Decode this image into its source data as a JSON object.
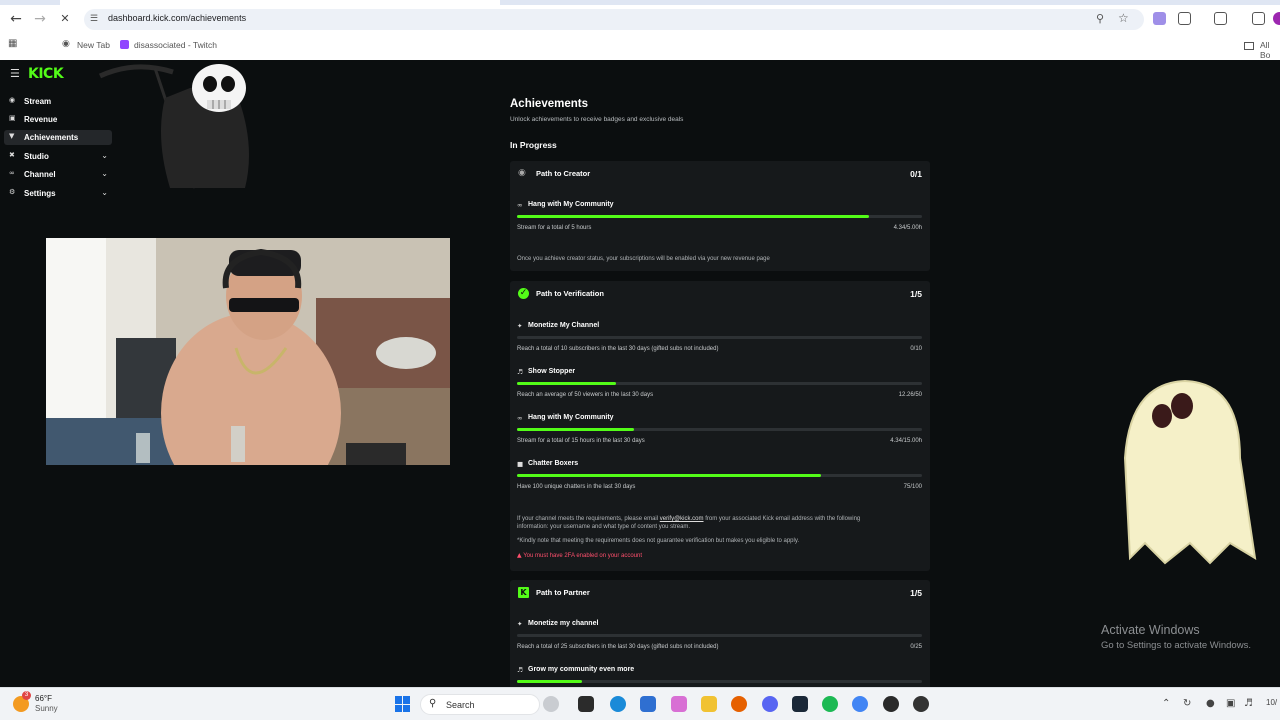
{
  "browser": {
    "url": "dashboard.kick.com/achievements",
    "bookmarks": [
      "New Tab",
      "disassociated - Twitch"
    ],
    "all_bookmarks": "All Bo"
  },
  "sidebar": {
    "logo": "KICK",
    "items": [
      {
        "label": "Stream",
        "icon": "broadcast-icon",
        "expandable": false
      },
      {
        "label": "Revenue",
        "icon": "revenue-icon",
        "expandable": false
      },
      {
        "label": "Achievements",
        "icon": "trophy-icon",
        "expandable": false,
        "active": true
      },
      {
        "label": "Studio",
        "icon": "studio-icon",
        "expandable": true
      },
      {
        "label": "Channel",
        "icon": "channel-icon",
        "expandable": true
      },
      {
        "label": "Settings",
        "icon": "gear-icon",
        "expandable": true
      }
    ]
  },
  "main": {
    "title": "Achievements",
    "subtitle": "Unlock achievements to receive badges and exclusive deals",
    "section": "In Progress",
    "cards": [
      {
        "title": "Path to Creator",
        "count": "0/1",
        "icon": "broadcast-icon",
        "tasks": [
          {
            "name": "Hang with My Community",
            "desc": "Stream for a total of 5 hours",
            "value": "4.34/5.00h",
            "progress": 0.868
          }
        ],
        "note": "Once you achieve creator status, your subscriptions will be enabled via your new revenue page"
      },
      {
        "title": "Path to Verification",
        "count": "1/5",
        "icon": "verified-badge-icon",
        "tasks": [
          {
            "name": "Monetize My Channel",
            "desc": "Reach a total of 10 subscribers in the last 30 days (gifted subs not included)",
            "value": "0/10",
            "progress": 0
          },
          {
            "name": "Show Stopper",
            "desc": "Reach an average of 50 viewers in the last 30 days",
            "value": "12.26/50",
            "progress": 0.245
          },
          {
            "name": "Hang with My Community",
            "desc": "Stream for a total of 15 hours in the last 30 days",
            "value": "4.34/15.00h",
            "progress": 0.289
          },
          {
            "name": "Chatter Boxers",
            "desc": "Have 100 unique chatters in the last 30 days",
            "value": "75/100",
            "progress": 0.75
          }
        ],
        "note1_before": "If your channel meets the requirements, please email",
        "note1_email": "verify@kick.com",
        "note1_after": "from your associated Kick email address with the following",
        "note2": "information: your username and what type of content you stream.",
        "note3": "*Kindly note that meeting the requirements does not guarantee verification but makes you eligible to apply.",
        "warning": "You must have 2FA enabled on your account"
      },
      {
        "title": "Path to Partner",
        "count": "1/5",
        "icon": "kick-logo-icon",
        "tasks": [
          {
            "name": "Monetize my channel",
            "desc": "Reach a total of 25 subscribers in the last 30 days (gifted subs not included)",
            "value": "0/25",
            "progress": 0
          },
          {
            "name": "Grow my community even more",
            "desc": "",
            "value": "",
            "progress": 0.16
          }
        ]
      }
    ]
  },
  "watermark": {
    "line1": "Activate Windows",
    "line2": "Go to Settings to activate Windows."
  },
  "taskbar": {
    "weather_temp": "66°F",
    "weather_cond": "Sunny",
    "weather_badge": "3",
    "search": "Search",
    "clock_fragment": "10/"
  }
}
